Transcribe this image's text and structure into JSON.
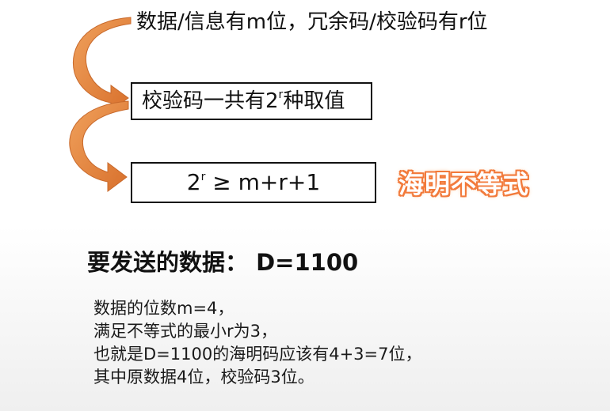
{
  "statement": {
    "text": "数据/信息有m位，冗余码/校验码有r位"
  },
  "box1": {
    "prefix": "校验码一共有2",
    "superscript": "r",
    "suffix": "种取值"
  },
  "box2": {
    "base": "2",
    "superscript": "r",
    "rest": " ≥ m+r+1"
  },
  "label": {
    "text": "海明不等式",
    "color": "#f27a3b"
  },
  "heading": {
    "text": "要发送的数据：  D=1100"
  },
  "explanation": {
    "lines": [
      "数据的位数m=4，",
      "满足不等式的最小r为3，",
      "也就是D=1100的海明码应该有4+3=7位，",
      "其中原数据4位，校验码3位。"
    ]
  },
  "colors": {
    "arrow_fill": "#e37d35",
    "arrow_stroke": "#c8692b",
    "text": "#111111"
  }
}
